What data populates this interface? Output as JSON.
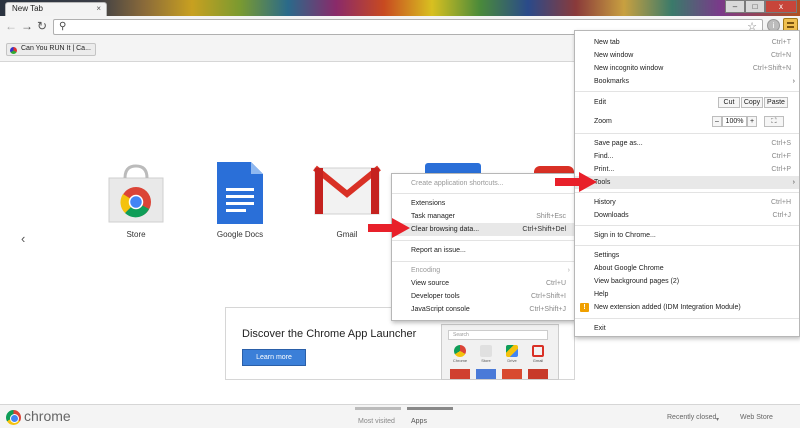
{
  "tab": {
    "title": "New Tab",
    "close": "×"
  },
  "window_controls": {
    "minimize": "–",
    "maximize": "□",
    "close": "x"
  },
  "bookmark": {
    "label": "Can You RUN It | Ca..."
  },
  "apps": [
    {
      "label": "Store"
    },
    {
      "label": "Google Docs"
    },
    {
      "label": "Gmail"
    }
  ],
  "nav": {
    "prev": "‹"
  },
  "promo": {
    "title": "Discover the Chrome App Launcher",
    "button": "Learn more",
    "search_placeholder": "Search",
    "mini_apps": [
      "Chrome",
      "Store",
      "Drive",
      "Gmail"
    ]
  },
  "brand": "chrome",
  "bottom": {
    "most_visited": "Most visited",
    "apps": "Apps",
    "recently_closed": "Recently closed",
    "web_store": "Web Store"
  },
  "main_menu": {
    "new_tab": {
      "label": "New tab",
      "shortcut": "Ctrl+T"
    },
    "new_window": {
      "label": "New window",
      "shortcut": "Ctrl+N"
    },
    "new_incognito": {
      "label": "New incognito window",
      "shortcut": "Ctrl+Shift+N"
    },
    "bookmarks": {
      "label": "Bookmarks"
    },
    "edit": {
      "label": "Edit",
      "cut": "Cut",
      "copy": "Copy",
      "paste": "Paste"
    },
    "zoom": {
      "label": "Zoom",
      "minus": "–",
      "value": "100%",
      "plus": "+"
    },
    "save_page": {
      "label": "Save page as...",
      "shortcut": "Ctrl+S"
    },
    "find": {
      "label": "Find...",
      "shortcut": "Ctrl+F"
    },
    "print": {
      "label": "Print...",
      "shortcut": "Ctrl+P"
    },
    "tools": {
      "label": "Tools"
    },
    "history": {
      "label": "History",
      "shortcut": "Ctrl+H"
    },
    "downloads": {
      "label": "Downloads",
      "shortcut": "Ctrl+J"
    },
    "sign_in": {
      "label": "Sign in to Chrome..."
    },
    "settings": {
      "label": "Settings"
    },
    "about": {
      "label": "About Google Chrome"
    },
    "background_pages": {
      "label": "View background pages (2)"
    },
    "help": {
      "label": "Help"
    },
    "new_extension": {
      "label": "New extension added (IDM Integration Module)",
      "badge": "!"
    },
    "exit": {
      "label": "Exit"
    }
  },
  "tools_menu": {
    "create_shortcuts": {
      "label": "Create application shortcuts..."
    },
    "extensions": {
      "label": "Extensions"
    },
    "task_manager": {
      "label": "Task manager",
      "shortcut": "Shift+Esc"
    },
    "clear_browsing": {
      "label": "Clear browsing data...",
      "shortcut": "Ctrl+Shift+Del"
    },
    "report_issue": {
      "label": "Report an issue..."
    },
    "encoding": {
      "label": "Encoding"
    },
    "view_source": {
      "label": "View source",
      "shortcut": "Ctrl+U"
    },
    "developer_tools": {
      "label": "Developer tools",
      "shortcut": "Ctrl+Shift+I"
    },
    "js_console": {
      "label": "JavaScript console",
      "shortcut": "Ctrl+Shift+J"
    }
  },
  "colors": {
    "arrow": "#e8202a",
    "menu_button": "#f0c050",
    "learn_more": "#3b7fd8"
  }
}
